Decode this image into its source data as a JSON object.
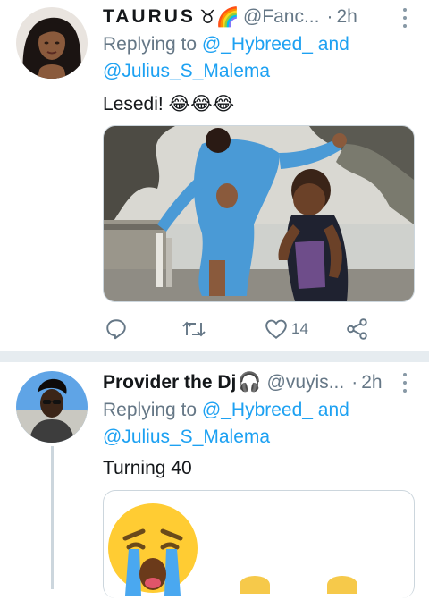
{
  "tweet1": {
    "name": "TAURUS",
    "name_emojis": "♉🌈",
    "handle": "@Fanc...",
    "separator": "·",
    "time": "2h",
    "replying_prefix": "Replying to ",
    "replying_user1": "@_Hybreed_",
    "replying_and": " and",
    "replying_user2": "@Julius_S_Malema",
    "text": "Lesedi! 😂😂😂",
    "like_count": "14"
  },
  "tweet2": {
    "name": "Provider the Dj",
    "name_emoji": "🎧",
    "handle": "@vuyis...",
    "separator": "·",
    "time": "2h",
    "replying_prefix": "Replying to ",
    "replying_user1": "@_Hybreed_",
    "replying_and": " and",
    "replying_user2": "@Julius_S_Malema",
    "text": "Turning 40"
  },
  "colors": {
    "accent": "#1da1f2",
    "secondary_text": "#657786",
    "divider": "#e6ecf0"
  },
  "icons": [
    "reply-icon",
    "retweet-icon",
    "like-icon",
    "share-icon",
    "more-icon"
  ]
}
